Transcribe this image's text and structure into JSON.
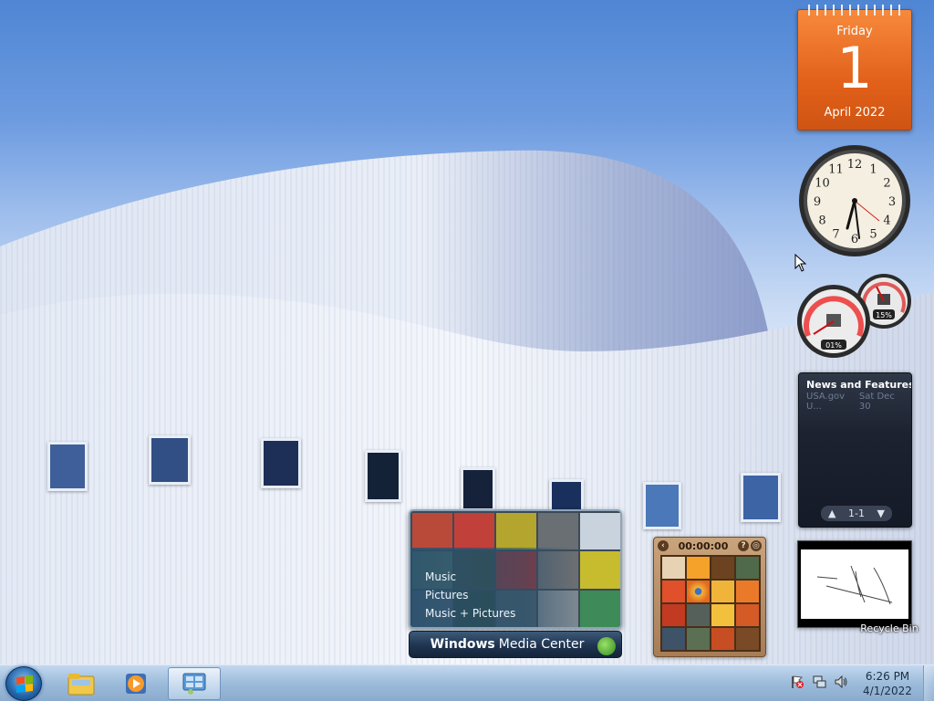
{
  "desktop": {
    "recycle_bin_label": "Recycle Bin"
  },
  "gadgets": {
    "calendar": {
      "weekday": "Friday",
      "day": "1",
      "month_year": "April 2022"
    },
    "clock": {
      "numerals": [
        "12",
        "1",
        "2",
        "3",
        "4",
        "5",
        "6",
        "7",
        "8",
        "9",
        "10",
        "11"
      ]
    },
    "cpu_meter": {
      "cpu": "01%",
      "memory": "15%",
      "cpu_value": 1,
      "memory_value": 15
    },
    "feed": {
      "title": "News and Features f...",
      "source": "USA.gov U...",
      "date": "Sat Dec 30",
      "page": "1-1"
    },
    "media_center": {
      "menu": [
        "Music",
        "Pictures",
        "Music + Pictures"
      ],
      "label_bold": "Windows",
      "label_rest": "Media Center"
    },
    "puzzle": {
      "timer": "00:00:00"
    }
  },
  "taskbar": {
    "time": "6:26 PM",
    "date": "4/1/2022",
    "pinned": [
      "Windows Explorer",
      "Windows Media Player",
      "Control Panel"
    ]
  },
  "colors": {
    "calendar": "#e2611a",
    "taskbar": "#a7c0dc",
    "sky": "#4f86d4"
  }
}
